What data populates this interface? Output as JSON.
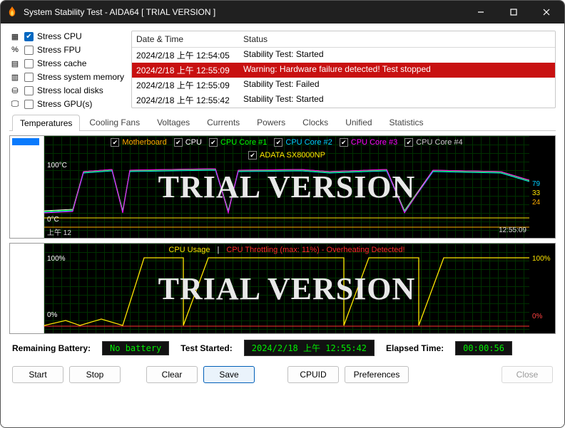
{
  "title": "System Stability Test - AIDA64  [ TRIAL VERSION ]",
  "stress": [
    {
      "label": "Stress CPU",
      "checked": true
    },
    {
      "label": "Stress FPU",
      "checked": false
    },
    {
      "label": "Stress cache",
      "checked": false
    },
    {
      "label": "Stress system memory",
      "checked": false
    },
    {
      "label": "Stress local disks",
      "checked": false
    },
    {
      "label": "Stress GPU(s)",
      "checked": false
    }
  ],
  "log": {
    "col1": "Date & Time",
    "col2": "Status",
    "rows": [
      {
        "t": "2024/2/18 上午 12:54:05",
        "s": "Stability Test: Started",
        "sel": false
      },
      {
        "t": "2024/2/18 上午 12:55:09",
        "s": "Warning: Hardware failure detected! Test stopped",
        "sel": true
      },
      {
        "t": "2024/2/18 上午 12:55:09",
        "s": "Stability Test: Failed",
        "sel": false
      },
      {
        "t": "2024/2/18 上午 12:55:42",
        "s": "Stability Test: Started",
        "sel": false
      }
    ]
  },
  "tabs": [
    "Temperatures",
    "Cooling Fans",
    "Voltages",
    "Currents",
    "Powers",
    "Clocks",
    "Unified",
    "Statistics"
  ],
  "active_tab": 0,
  "temp_legend": [
    {
      "name": "Motherboard",
      "color": "#ffae00"
    },
    {
      "name": "CPU",
      "color": "#ffffff"
    },
    {
      "name": "CPU Core #1",
      "color": "#00ff00"
    },
    {
      "name": "CPU Core #2",
      "color": "#00ccff"
    },
    {
      "name": "CPU Core #3",
      "color": "#ff00ff"
    },
    {
      "name": "CPU Core #4",
      "color": "#cccccc"
    }
  ],
  "ssd_legend": "ADATA SX8000NP",
  "temp_axis_top": "100°C",
  "temp_axis_bot": "0°C",
  "temp_x_left": "上午 12",
  "temp_x_right": "12:55:09",
  "temp_rvals": [
    "79",
    "33",
    "24"
  ],
  "temp_rcolors": [
    "#00ccff",
    "#ffe600",
    "#ffae00"
  ],
  "cpu_legend_a": "CPU Usage",
  "cpu_legend_sep": "  |  ",
  "cpu_legend_b": "CPU Throttling (max: 11%) - Overheating Detected!",
  "cpu_axis_top": "100%",
  "cpu_axis_bot": "0%",
  "cpu_rtop": "100%",
  "cpu_rbot": "0%",
  "watermark": "TRIAL VERSION",
  "status": {
    "batt_label": "Remaining Battery:",
    "batt_value": "No battery",
    "started_label": "Test Started:",
    "started_value": "2024/2/18 上午 12:55:42",
    "elapsed_label": "Elapsed Time:",
    "elapsed_value": "00:00:56"
  },
  "buttons": {
    "start": "Start",
    "stop": "Stop",
    "clear": "Clear",
    "save": "Save",
    "cpuid": "CPUID",
    "prefs": "Preferences",
    "close": "Close"
  },
  "chart_data": [
    {
      "type": "line",
      "title": "Temperatures",
      "ylabel": "°C",
      "ylim": [
        0,
        100
      ],
      "x_range": [
        "12:54:05",
        "12:55:42"
      ],
      "series": [
        {
          "name": "Motherboard",
          "color": "#ffae00",
          "approx_values": [
            24,
            24,
            24,
            24,
            24,
            24,
            24,
            24,
            24
          ]
        },
        {
          "name": "CPU",
          "color": "#ffffff",
          "approx_values": [
            40,
            95,
            98,
            96,
            97,
            95,
            40,
            95,
            79
          ]
        },
        {
          "name": "CPU Core #1",
          "color": "#00ff00",
          "approx_values": [
            42,
            96,
            98,
            97,
            97,
            95,
            42,
            96,
            79
          ]
        },
        {
          "name": "CPU Core #2",
          "color": "#00ccff",
          "approx_values": [
            41,
            95,
            97,
            96,
            97,
            94,
            41,
            95,
            79
          ]
        },
        {
          "name": "CPU Core #3",
          "color": "#ff00ff",
          "approx_values": [
            41,
            96,
            98,
            96,
            96,
            95,
            41,
            96,
            79
          ]
        },
        {
          "name": "CPU Core #4",
          "color": "#cccccc",
          "approx_values": [
            40,
            95,
            97,
            95,
            96,
            94,
            40,
            95,
            78
          ]
        },
        {
          "name": "ADATA SX8000NP",
          "color": "#ffe600",
          "approx_values": [
            33,
            33,
            33,
            33,
            33,
            33,
            33,
            33,
            33
          ]
        }
      ]
    },
    {
      "type": "line",
      "title": "CPU Usage / Throttling",
      "ylabel": "%",
      "ylim": [
        0,
        100
      ],
      "x_range": [
        "12:54:05",
        "12:55:42"
      ],
      "series": [
        {
          "name": "CPU Usage",
          "color": "#ffe600",
          "approx_values": [
            5,
            100,
            100,
            5,
            100,
            100,
            5,
            100,
            100
          ]
        },
        {
          "name": "CPU Throttling",
          "color": "#ff3030",
          "approx_values": [
            0,
            0,
            0,
            0,
            0,
            0,
            0,
            0,
            0
          ],
          "max_observed": 11
        }
      ]
    }
  ]
}
